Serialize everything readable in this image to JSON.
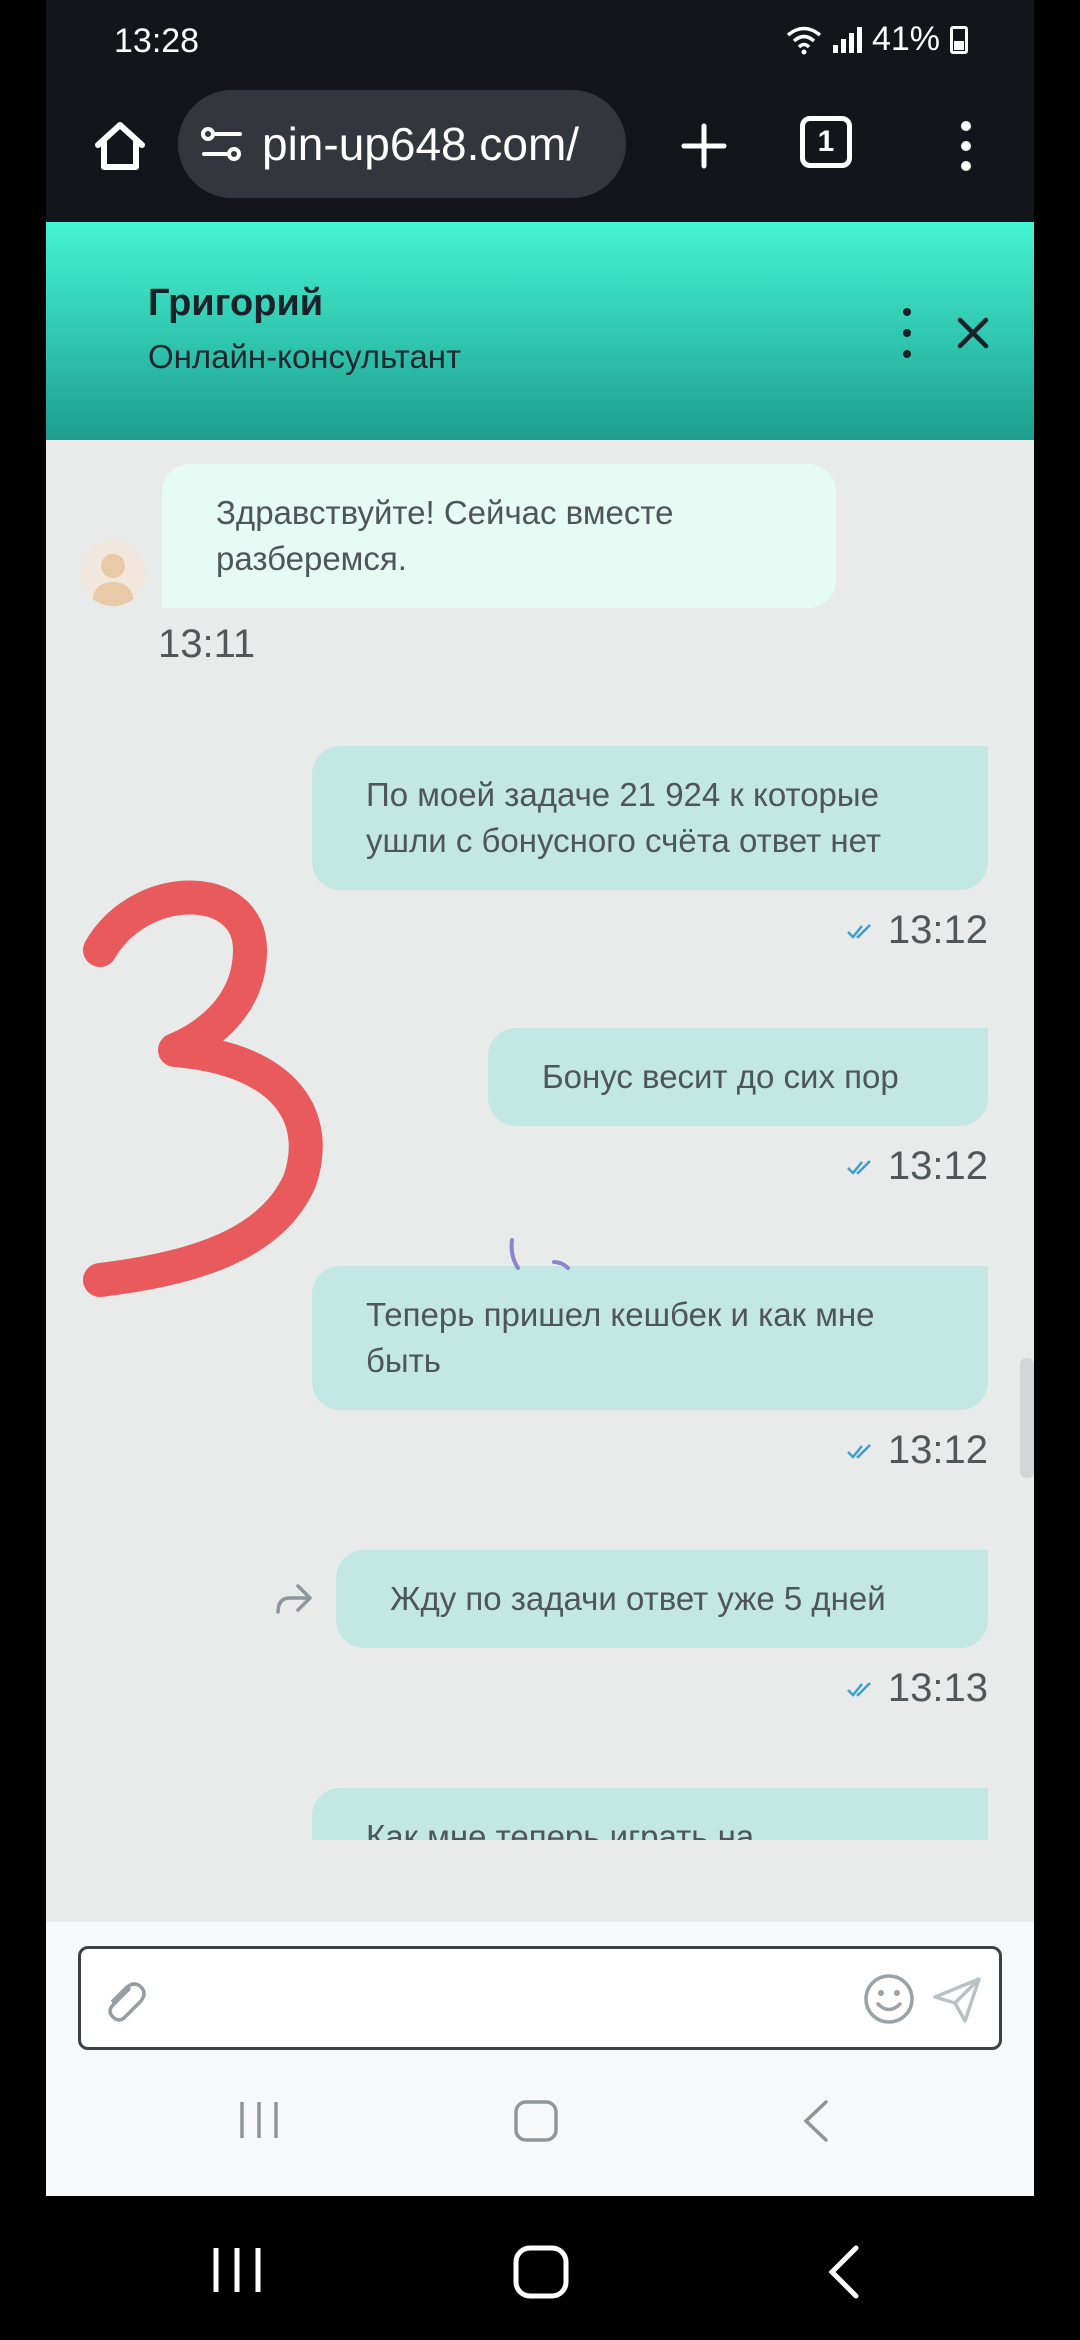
{
  "status_bar": {
    "time": "13:28",
    "battery": "41%"
  },
  "browser": {
    "url": "pin-up648.com/",
    "tab_count": "1"
  },
  "chat": {
    "agent_name": "Григорий",
    "agent_role": "Онлайн-консультант",
    "messages": [
      {
        "direction": "incoming",
        "lines": [
          "Здравствуйте! Сейчас вместе",
          "разберемся."
        ],
        "time": "13:11"
      },
      {
        "direction": "outgoing",
        "lines": [
          "По моей задаче 21 924 к которые",
          "ушли с бонусного счёта ответ нет"
        ],
        "time": "13:12"
      },
      {
        "direction": "outgoing",
        "lines": [
          "Бонус весит до сих пор"
        ],
        "time": "13:12"
      },
      {
        "direction": "outgoing",
        "lines": [
          "Теперь пришел кешбек и как мне",
          "быть"
        ],
        "time": "13:12"
      },
      {
        "direction": "outgoing",
        "lines": [
          "Жду по задачи ответ уже 5 дней"
        ],
        "time": "13:13"
      },
      {
        "direction": "outgoing",
        "lines": [
          "Как мне теперь играть на"
        ],
        "time": ""
      }
    ]
  },
  "colors": {
    "header_top": "#45f4d2",
    "header_bottom": "#1e9d8d",
    "bubble_incoming": "#e6fbf4",
    "bubble_outgoing": "#c3e8e4",
    "annotation": "#e85a5c"
  },
  "icons": {
    "home": "home-icon",
    "site_settings": "site-settings-icon",
    "new_tab": "plus-icon",
    "menu": "more-vertical-icon",
    "close": "close-icon",
    "attach": "paperclip-icon",
    "emoji": "smiley-icon",
    "send": "send-icon",
    "read_receipt": "double-check-icon",
    "forward": "forward-icon"
  }
}
